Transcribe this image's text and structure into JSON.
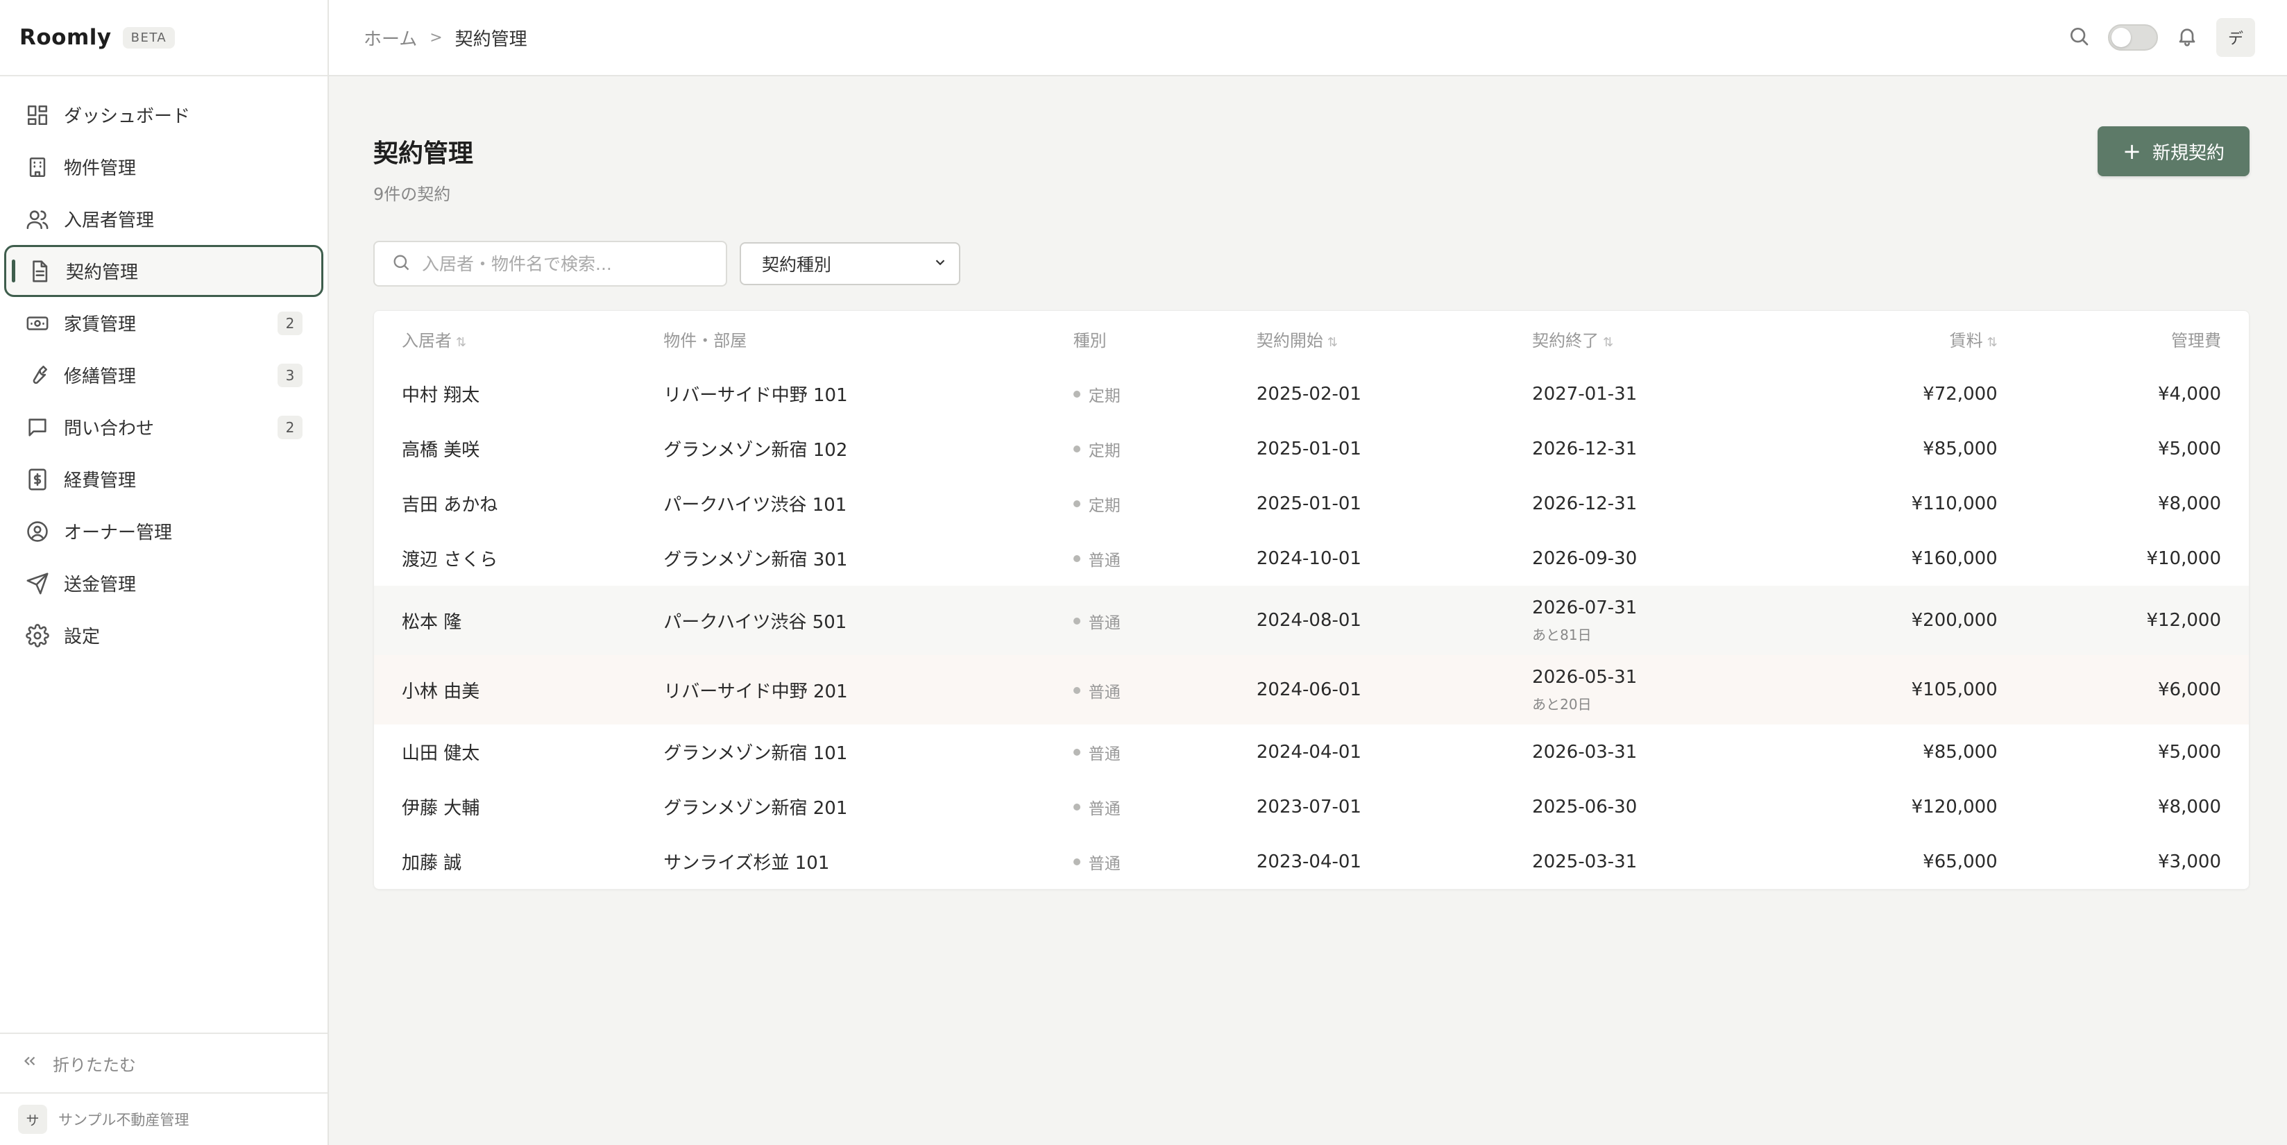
{
  "app": {
    "name": "Roomly",
    "badge": "BETA"
  },
  "sidebar": {
    "items": [
      {
        "label": "ダッシュボード",
        "icon": "dashboard-icon",
        "badge": ""
      },
      {
        "label": "物件管理",
        "icon": "building-icon",
        "badge": ""
      },
      {
        "label": "入居者管理",
        "icon": "users-icon",
        "badge": ""
      },
      {
        "label": "契約管理",
        "icon": "document-icon",
        "badge": "",
        "active": true
      },
      {
        "label": "家賃管理",
        "icon": "banknote-icon",
        "badge": "2"
      },
      {
        "label": "修繕管理",
        "icon": "wrench-icon",
        "badge": "3"
      },
      {
        "label": "問い合わせ",
        "icon": "message-icon",
        "badge": "2"
      },
      {
        "label": "経費管理",
        "icon": "receipt-dollar-icon",
        "badge": ""
      },
      {
        "label": "オーナー管理",
        "icon": "user-circle-icon",
        "badge": ""
      },
      {
        "label": "送金管理",
        "icon": "send-icon",
        "badge": ""
      },
      {
        "label": "設定",
        "icon": "gear-icon",
        "badge": ""
      }
    ],
    "collapse_label": "折りたたむ",
    "org": {
      "avatar": "サ",
      "name": "サンプル不動産管理"
    }
  },
  "topbar": {
    "breadcrumb": {
      "home": "ホーム",
      "separator": ">",
      "current": "契約管理"
    },
    "user_avatar": "デ"
  },
  "page": {
    "title": "契約管理",
    "subtitle": "9件の契約",
    "new_button": "新規契約",
    "search_placeholder": "入居者・物件名で検索...",
    "filter_select": "契約種別"
  },
  "table": {
    "headers": {
      "tenant": "入居者",
      "property": "物件・部屋",
      "type": "種別",
      "start": "契約開始",
      "end": "契約終了",
      "rent": "賃料",
      "fee": "管理費"
    },
    "rows": [
      {
        "tenant": "中村 翔太",
        "property": "リバーサイド中野 101",
        "type": "定期",
        "start": "2025-02-01",
        "end": "2027-01-31",
        "remain": "",
        "rent": "¥72,000",
        "fee": "¥4,000"
      },
      {
        "tenant": "高橋 美咲",
        "property": "グランメゾン新宿 102",
        "type": "定期",
        "start": "2025-01-01",
        "end": "2026-12-31",
        "remain": "",
        "rent": "¥85,000",
        "fee": "¥5,000"
      },
      {
        "tenant": "吉田 あかね",
        "property": "パークハイツ渋谷 101",
        "type": "定期",
        "start": "2025-01-01",
        "end": "2026-12-31",
        "remain": "",
        "rent": "¥110,000",
        "fee": "¥8,000"
      },
      {
        "tenant": "渡辺 さくら",
        "property": "グランメゾン新宿 301",
        "type": "普通",
        "start": "2024-10-01",
        "end": "2026-09-30",
        "remain": "",
        "rent": "¥160,000",
        "fee": "¥10,000"
      },
      {
        "tenant": "松本 隆",
        "property": "パークハイツ渋谷 501",
        "type": "普通",
        "start": "2024-08-01",
        "end": "2026-07-31",
        "remain": "あと81日",
        "rent": "¥200,000",
        "fee": "¥12,000"
      },
      {
        "tenant": "小林 由美",
        "property": "リバーサイド中野 201",
        "type": "普通",
        "start": "2024-06-01",
        "end": "2026-05-31",
        "remain": "あと20日",
        "rent": "¥105,000",
        "fee": "¥6,000"
      },
      {
        "tenant": "山田 健太",
        "property": "グランメゾン新宿 101",
        "type": "普通",
        "start": "2024-04-01",
        "end": "2026-03-31",
        "remain": "",
        "rent": "¥85,000",
        "fee": "¥5,000"
      },
      {
        "tenant": "伊藤 大輔",
        "property": "グランメゾン新宿 201",
        "type": "普通",
        "start": "2023-07-01",
        "end": "2025-06-30",
        "remain": "",
        "rent": "¥120,000",
        "fee": "¥8,000"
      },
      {
        "tenant": "加藤 誠",
        "property": "サンライズ杉並 101",
        "type": "普通",
        "start": "2023-04-01",
        "end": "2025-03-31",
        "remain": "",
        "rent": "¥65,000",
        "fee": "¥3,000"
      }
    ]
  },
  "colors": {
    "accent": "#3f5e4d",
    "button": "#5d7a68"
  }
}
